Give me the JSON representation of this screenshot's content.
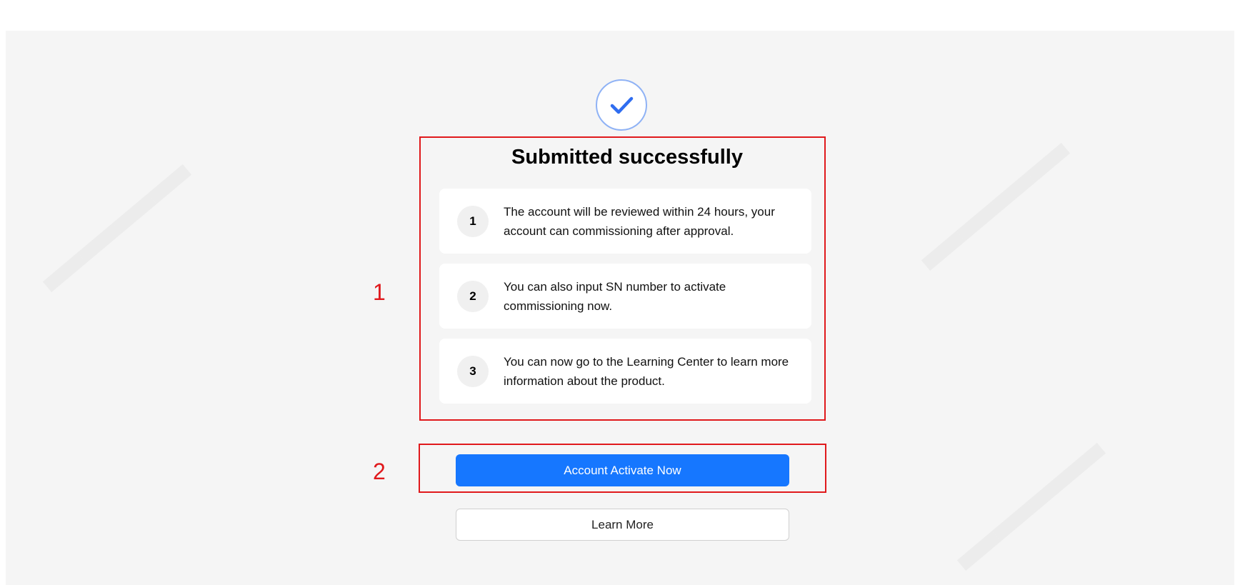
{
  "result": {
    "icon": "checkmark-icon",
    "title": "Submitted successfully"
  },
  "steps": [
    {
      "number": "1",
      "text": "The account will be reviewed within 24 hours, your account can commissioning after approval."
    },
    {
      "number": "2",
      "text": "You can also input SN number to activate commissioning now."
    },
    {
      "number": "3",
      "text": "You can now go to the Learning Center to learn more information about the product."
    }
  ],
  "annotations": {
    "box1_label": "1",
    "box2_label": "2"
  },
  "actions": {
    "activate_label": "Account Activate Now",
    "learn_more_label": "Learn More"
  },
  "colors": {
    "primary": "#1677ff",
    "annotation": "#e0191c",
    "background": "#f5f5f5"
  }
}
